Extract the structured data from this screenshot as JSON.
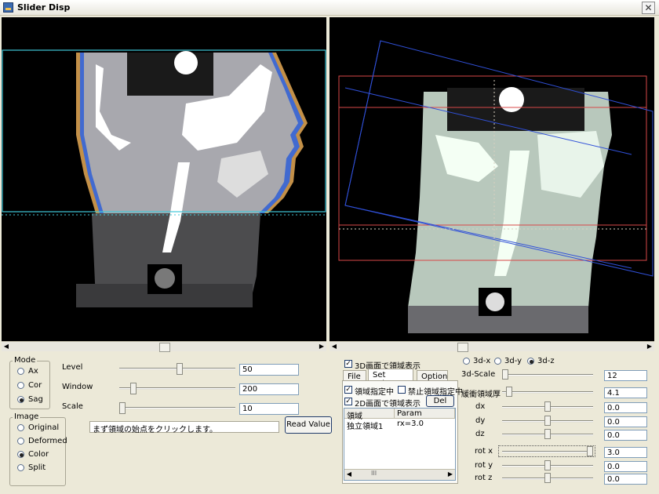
{
  "window": {
    "title": "Slider Disp"
  },
  "mode": {
    "label": "Mode",
    "options": [
      "Ax",
      "Cor",
      "Sag"
    ],
    "selected": "Sag"
  },
  "image": {
    "label": "Image",
    "options": [
      "Original",
      "Deformed",
      "Color",
      "Split"
    ],
    "selected": "Color"
  },
  "sliders_left": [
    {
      "label": "Level",
      "value": "50",
      "fraction": 0.52
    },
    {
      "label": "Window",
      "value": "200",
      "fraction": 0.1
    },
    {
      "label": "Scale",
      "value": "10",
      "fraction": 0.0
    }
  ],
  "status": {
    "message": "まず領域の始点をクリックします。"
  },
  "read_value_button": "Read Value",
  "checkbox_3d": "3D画面で領域表示",
  "tabs": [
    "File",
    "Set Volume",
    "Option"
  ],
  "active_tab": "Set Volume",
  "checkbox_region": "領域指定中",
  "checkbox_forbid": "禁止領域指定中",
  "checkbox_2d": "2D画面で領域表示",
  "del_button": "Del",
  "region_table": {
    "headers": [
      "領域",
      "Param"
    ],
    "rows": [
      {
        "name": "独立領域1",
        "param": "rx=3.0"
      }
    ],
    "scroll_glyph": "III"
  },
  "view3d": {
    "options": [
      "3d-x",
      "3d-y",
      "3d-z"
    ],
    "selected": "3d-z"
  },
  "sliders_right": [
    {
      "label": "3d-Scale",
      "value": "12",
      "fraction": 0.0
    },
    {
      "label": "緩衝領域厚",
      "value": "4.1",
      "fraction": 0.05
    },
    {
      "label": "dx",
      "value": "0.0",
      "fraction": 0.5
    },
    {
      "label": "dy",
      "value": "0.0",
      "fraction": 0.5
    },
    {
      "label": "dz",
      "value": "0.0",
      "fraction": 0.5
    },
    {
      "label": "rot x",
      "value": "3.0",
      "fraction": 1.0
    },
    {
      "label": "rot y",
      "value": "0.0",
      "fraction": 0.5
    },
    {
      "label": "rot z",
      "value": "0.0",
      "fraction": 0.5
    }
  ],
  "colors": {
    "cyan_box": "#40c8d8",
    "blue_box": "#3050d8",
    "red_box": "#d84848",
    "bone": "#ffffff",
    "tissue": "#9a9aa0"
  },
  "scroll_left_fraction": 0.5,
  "scroll_right_fraction": 0.4
}
